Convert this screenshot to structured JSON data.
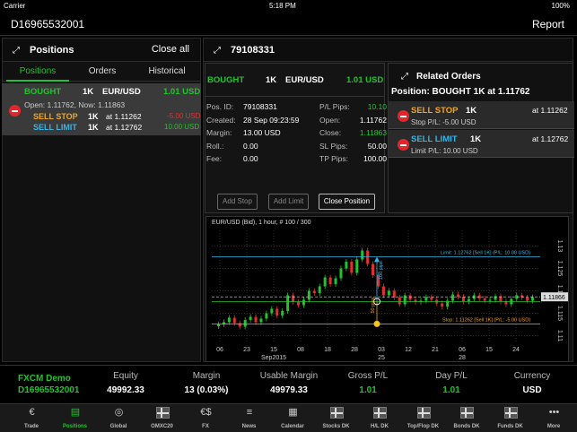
{
  "status": {
    "carrier": "Carrier",
    "time": "5:18 PM",
    "battery": "100%"
  },
  "account": {
    "id": "D16965532001",
    "report": "Report"
  },
  "positions_panel": {
    "title": "Positions",
    "close_all": "Close all",
    "tabs": [
      "Positions",
      "Orders",
      "Historical"
    ],
    "row": {
      "side": "BOUGHT",
      "size": "1K",
      "pair": "EUR/USD",
      "pl": "1.01 USD",
      "detail": "Open: 1.11762, Now: 1.11863",
      "stop": {
        "label": "SELL STOP",
        "size": "1K",
        "at": "at 1.11262",
        "pl": "-5.00 USD"
      },
      "limit": {
        "label": "SELL LIMIT",
        "size": "1K",
        "at": "at 1.12762",
        "pl": "10.00 USD"
      }
    }
  },
  "trade_panel": {
    "title": "79108331",
    "header": {
      "side": "BOUGHT",
      "size": "1K",
      "pair": "EUR/USD",
      "pl": "1.01 USD"
    },
    "fields_left": [
      {
        "label": "Pos. ID:",
        "value": "79108331"
      },
      {
        "label": "Created:",
        "value": "28 Sep 09:23:59"
      },
      {
        "label": "Margin:",
        "value": "13.00 USD"
      },
      {
        "label": "Roll.:",
        "value": "0.00"
      },
      {
        "label": "Fee:",
        "value": "0.00"
      }
    ],
    "fields_right": [
      {
        "label": "P/L Pips:",
        "value": "10.10"
      },
      {
        "label": "Open:",
        "value": "1.11762"
      },
      {
        "label": "Close:",
        "value": "1.11863"
      },
      {
        "label": "SL Pips:",
        "value": "50.00"
      },
      {
        "label": "TP Pips:",
        "value": "100.00"
      }
    ],
    "buttons": {
      "add_stop": "Add Stop",
      "add_limit": "Add Limit",
      "close": "Close Position"
    }
  },
  "related_orders": {
    "title": "Related Orders",
    "position": "Position: BOUGHT 1K at 1.11762",
    "orders": [
      {
        "label": "SELL STOP",
        "size": "1K",
        "at": "at 1.11262",
        "sub": "Stop P/L: -5.00 USD"
      },
      {
        "label": "SELL LIMIT",
        "size": "1K",
        "at": "at 1.12762",
        "sub": "Limit P/L: 10.00 USD"
      }
    ]
  },
  "chart_data": {
    "type": "candlestick",
    "title": "EUR/USD (Bid), 1 hour, # 100 / 300",
    "ylim": [
      1.1085,
      1.1335
    ],
    "yticks": [
      "1.13",
      "1.125",
      "1.12",
      "1.115",
      "1.11"
    ],
    "xticks": [
      {
        "t": "06",
        "sub": ""
      },
      {
        "t": "23",
        "sub": ""
      },
      {
        "t": "15",
        "sub": "Sep2015"
      },
      {
        "t": "08",
        "sub": ""
      },
      {
        "t": "18",
        "sub": ""
      },
      {
        "t": "28",
        "sub": ""
      },
      {
        "t": "03",
        "sub": "25"
      },
      {
        "t": "12",
        "sub": ""
      },
      {
        "t": "21",
        "sub": ""
      },
      {
        "t": "06",
        "sub": "28"
      },
      {
        "t": "15",
        "sub": ""
      },
      {
        "t": "24",
        "sub": ""
      }
    ],
    "current_price": "1.11866",
    "limit_label": "Limit: 1.12762 [Sell 1K] (P/L: 10.00 USD)",
    "stop_label": "Stop: 1.11262 [Sell 1K] (P/L: -5.00 USD)",
    "limit_pips": "100 pips",
    "stop_pips": "50 pips",
    "limit_price": 1.12762,
    "stop_price": 1.11262,
    "open_price": 1.11762,
    "closes": [
      1.1125,
      1.113,
      1.114,
      1.1128,
      1.112,
      1.1135,
      1.1142,
      1.113,
      1.1138,
      1.115,
      1.116,
      1.1145,
      1.1155,
      1.119,
      1.1175,
      1.1168,
      1.118,
      1.12,
      1.1195,
      1.121,
      1.123,
      1.1215,
      1.1228,
      1.125,
      1.1265,
      1.124,
      1.127,
      1.129,
      1.126,
      1.1235,
      1.121,
      1.119,
      1.12,
      1.1185,
      1.117,
      1.119,
      1.118,
      1.1175,
      1.1178,
      1.1186,
      1.118,
      1.1172,
      1.1165,
      1.1178,
      1.1192,
      1.1187,
      1.1176,
      1.1182,
      1.119,
      1.1183,
      1.1178,
      1.118,
      1.1188,
      1.1176,
      1.117,
      1.1182,
      1.119,
      1.1185,
      1.1178,
      1.1186
    ]
  },
  "summary": {
    "name": "FXCM Demo",
    "account": "D16965532001",
    "cols": [
      {
        "label": "Equity",
        "value": "49992.33",
        "color": "#ffffff"
      },
      {
        "label": "Margin",
        "value": "13 (0.03%)",
        "color": "#ffffff"
      },
      {
        "label": "Usable Margin",
        "value": "49979.33",
        "color": "#ffffff"
      },
      {
        "label": "Gross P/L",
        "value": "1.01",
        "color": "#22c32e"
      },
      {
        "label": "Day P/L",
        "value": "1.01",
        "color": "#22c32e"
      },
      {
        "label": "Currency",
        "value": "USD",
        "color": "#ffffff"
      }
    ]
  },
  "tabbar": [
    {
      "label": "Trade",
      "icon": "trade-icon"
    },
    {
      "label": "Positions",
      "icon": "briefcase-icon",
      "active": true
    },
    {
      "label": "Global",
      "icon": "globe-icon"
    },
    {
      "label": "OMXC20",
      "icon": "flag-icon"
    },
    {
      "label": "FX",
      "icon": "currency-icon"
    },
    {
      "label": "News",
      "icon": "news-icon"
    },
    {
      "label": "Calendar",
      "icon": "calendar-icon"
    },
    {
      "label": "Stocks DK",
      "icon": "flag-icon"
    },
    {
      "label": "H/L DK",
      "icon": "flag-icon"
    },
    {
      "label": "Top/Flop DK",
      "icon": "flag-icon"
    },
    {
      "label": "Bonds DK",
      "icon": "flag-icon"
    },
    {
      "label": "Funds DK",
      "icon": "flag-icon"
    },
    {
      "label": "More",
      "icon": "more-icon"
    }
  ]
}
